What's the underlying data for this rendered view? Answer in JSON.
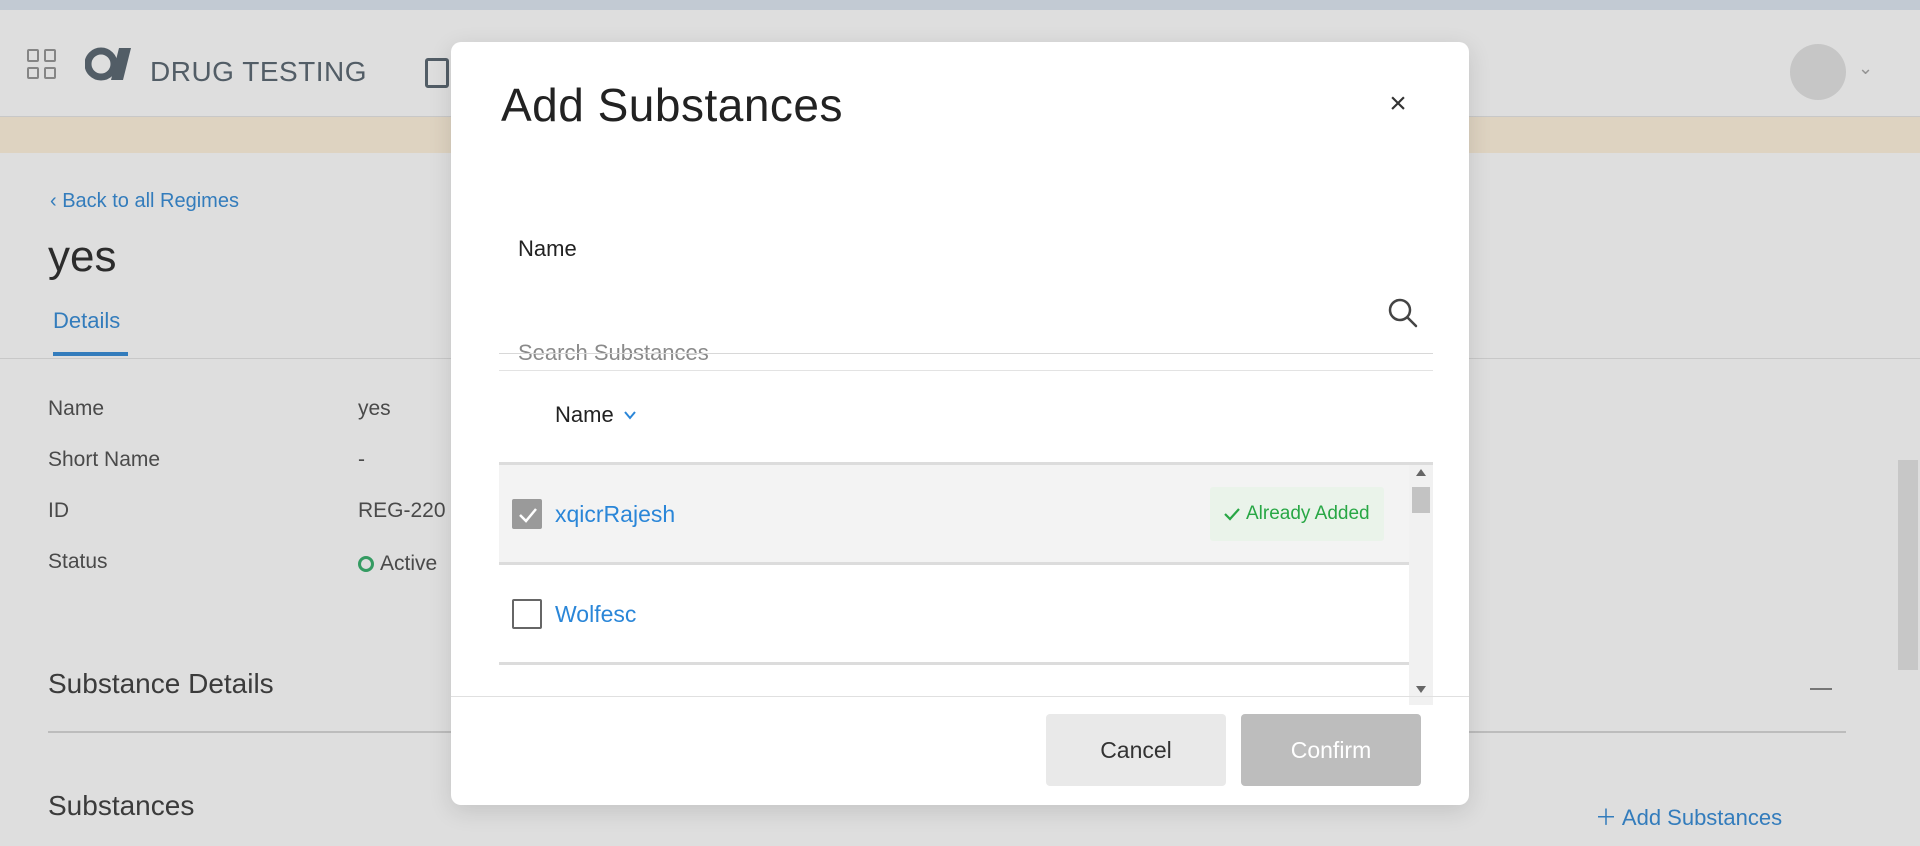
{
  "app": {
    "brand": "DRUG TESTING"
  },
  "page": {
    "back_link": "Back to all Regimes",
    "title": "yes",
    "tabs": [
      {
        "label": "Details"
      }
    ],
    "fields": [
      {
        "label": "Name",
        "value": "yes"
      },
      {
        "label": "Short Name",
        "value": "-"
      },
      {
        "label": "ID",
        "value": "REG-220"
      },
      {
        "label": "Status",
        "value": "Active"
      }
    ],
    "sections": {
      "substance_details": "Substance Details",
      "substances": "Substances",
      "add_substances": "Add Substances"
    }
  },
  "modal": {
    "title": "Add Substances",
    "search": {
      "label": "Name",
      "placeholder": "Search Substances",
      "value": ""
    },
    "table": {
      "column_header": "Name",
      "rows": [
        {
          "name": "xqicrRajesh",
          "checked": true,
          "badge": "Already Added"
        },
        {
          "name": "Wolfesc",
          "checked": false,
          "badge": ""
        }
      ]
    },
    "buttons": {
      "cancel": "Cancel",
      "confirm": "Confirm"
    }
  },
  "colors": {
    "accent": "#2a86d8",
    "success": "#28a745",
    "confirm_disabled": "#bdbdbd"
  },
  "icons": [
    "apps-grid-icon",
    "brand-logo",
    "clipboard-icon",
    "avatar",
    "chevron-down-icon",
    "search-icon",
    "close-icon",
    "check-icon"
  ]
}
